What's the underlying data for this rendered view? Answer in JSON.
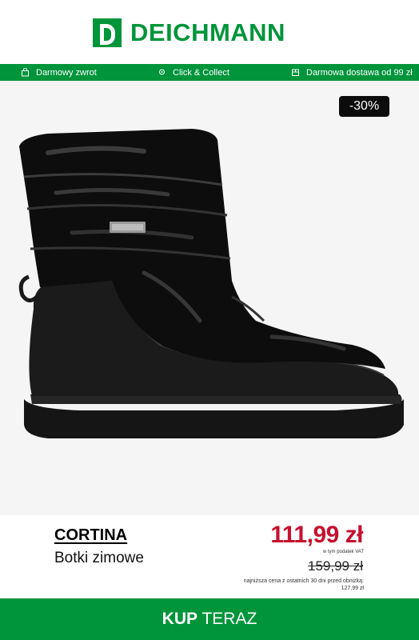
{
  "brand": {
    "name": "DEICHMANN",
    "color": "#00953a"
  },
  "usp_bar": [
    {
      "icon": "return-bag-icon",
      "label": "Darmowy zwrot"
    },
    {
      "icon": "location-pin-icon",
      "label": "Click & Collect"
    },
    {
      "icon": "delivery-box-icon",
      "label": "Darmowa dostawa od 99 zł"
    }
  ],
  "product": {
    "discount_badge": "-30%",
    "name": "CORTINA",
    "category": "Botki zimowe",
    "price": "111,99 zł",
    "vat_note": "w tym podatek VAT",
    "old_price": "159,99 zł",
    "lowest_price_note": "najniższa cena z ostatnich 30 dni przed obniżką:",
    "lowest_price": "127,99 zł",
    "price_color": "#c8102e"
  },
  "cta": {
    "bold": "KUP",
    "rest": " TERAZ"
  }
}
